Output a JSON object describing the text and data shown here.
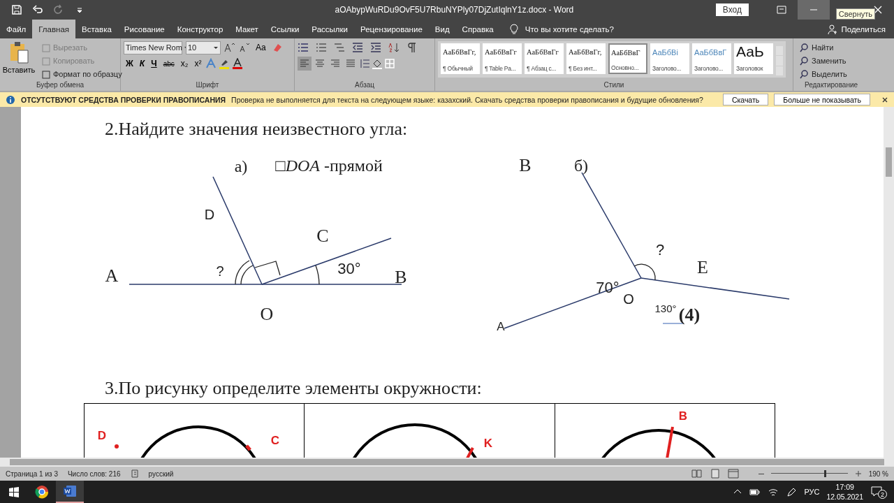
{
  "window": {
    "title": "aOAbypWuRDu9OvF5U7RbuNYPly07DjZutIqlnY1z.docx  -  Word",
    "sign_in": "Вход",
    "tooltip": "Свернуть"
  },
  "tabs": [
    {
      "label": "Файл",
      "selected": false
    },
    {
      "label": "Главная",
      "selected": true
    },
    {
      "label": "Вставка",
      "selected": false
    },
    {
      "label": "Рисование",
      "selected": false
    },
    {
      "label": "Конструктор",
      "selected": false
    },
    {
      "label": "Макет",
      "selected": false
    },
    {
      "label": "Ссылки",
      "selected": false
    },
    {
      "label": "Рассылки",
      "selected": false
    },
    {
      "label": "Рецензирование",
      "selected": false
    },
    {
      "label": "Вид",
      "selected": false
    },
    {
      "label": "Справка",
      "selected": false
    }
  ],
  "tell_me": {
    "placeholder": "Что вы хотите сделать?"
  },
  "share": "Поделиться",
  "ribbon": {
    "clipboard": {
      "label": "Буфер обмена",
      "paste": "Вставить",
      "items": [
        {
          "label": "Вырезать",
          "disabled": true
        },
        {
          "label": "Копировать",
          "disabled": true
        },
        {
          "label": "Формат по образцу",
          "disabled": false
        }
      ]
    },
    "font": {
      "label": "Шрифт",
      "name": "Times New Rom",
      "size": "10",
      "case": "Aa",
      "format": [
        "Ж",
        "К",
        "Ч",
        "abc",
        "x₂",
        "x²"
      ]
    },
    "paragraph": {
      "label": "Абзац",
      "align": [
        {
          "selected": true
        },
        {
          "selected": false
        },
        {
          "selected": false
        },
        {
          "selected": false
        }
      ]
    },
    "styles": {
      "label": "Стили",
      "items": [
        {
          "preview": "АаБбВвГг,",
          "name": "¶ Обычный",
          "kind": "body",
          "selected": false
        },
        {
          "preview": "АаБбВвГг",
          "name": "¶ Table Pa...",
          "kind": "body",
          "selected": false
        },
        {
          "preview": "АаБбВвГг",
          "name": "¶ Абзац с...",
          "kind": "body",
          "selected": false
        },
        {
          "preview": "АаБбВвГг,",
          "name": "¶ Без инт...",
          "kind": "body",
          "selected": false
        },
        {
          "preview": "АаБбВвГ",
          "name": "Основно...",
          "kind": "body",
          "selected": true
        },
        {
          "preview": "АаБбВі",
          "name": "Заголово...",
          "kind": "heading",
          "selected": false
        },
        {
          "preview": "АаБбВвГ",
          "name": "Заголово...",
          "kind": "heading",
          "selected": false
        },
        {
          "preview": "АаЬ",
          "name": "Заголовок",
          "kind": "title",
          "selected": false
        }
      ]
    },
    "editing": {
      "label": "Редактирование",
      "items": [
        "Найти",
        "Заменить",
        "Выделить"
      ]
    }
  },
  "infobar": {
    "title": "ОТСУТСТВУЮТ СРЕДСТВА ПРОВЕРКИ ПРАВОПИСАНИЯ",
    "message": "Проверка не выполняется для текста на следующем языке: казахский. Скачать средства проверки правописания и будущие обновления?",
    "buttons": [
      "Скачать",
      "Больше не показывать"
    ]
  },
  "document": {
    "heading_2": "2.Найдите значения неизвестного угла:",
    "figure_a": {
      "label": "а)",
      "caption": "□*DOA* -прямой",
      "points": [
        "A",
        "D",
        "C",
        "B",
        "O"
      ],
      "angles": [
        "?",
        "30°"
      ]
    },
    "figure_b": {
      "points": [
        "B",
        "E",
        "O",
        "A"
      ],
      "label": "б)",
      "angles": [
        "?",
        "70°",
        "130°"
      ],
      "number": "(4)"
    },
    "heading_3": "3.По рисунку определите элементы окружности:",
    "table": {
      "cells": [
        {
          "labels": [
            "D",
            "C"
          ]
        },
        {
          "labels": [
            "K"
          ]
        },
        {
          "labels": [
            "B"
          ]
        }
      ]
    }
  },
  "status_bar": {
    "page": "Страница 1 из 3",
    "words": "Число слов: 216",
    "language": "русский",
    "zoom": "190 %",
    "zoom_slider": {
      "level": 0.7
    }
  },
  "taskbar": {
    "language": "РУС",
    "time": "17:09",
    "date": "12.05.2021",
    "notifications": "2"
  }
}
